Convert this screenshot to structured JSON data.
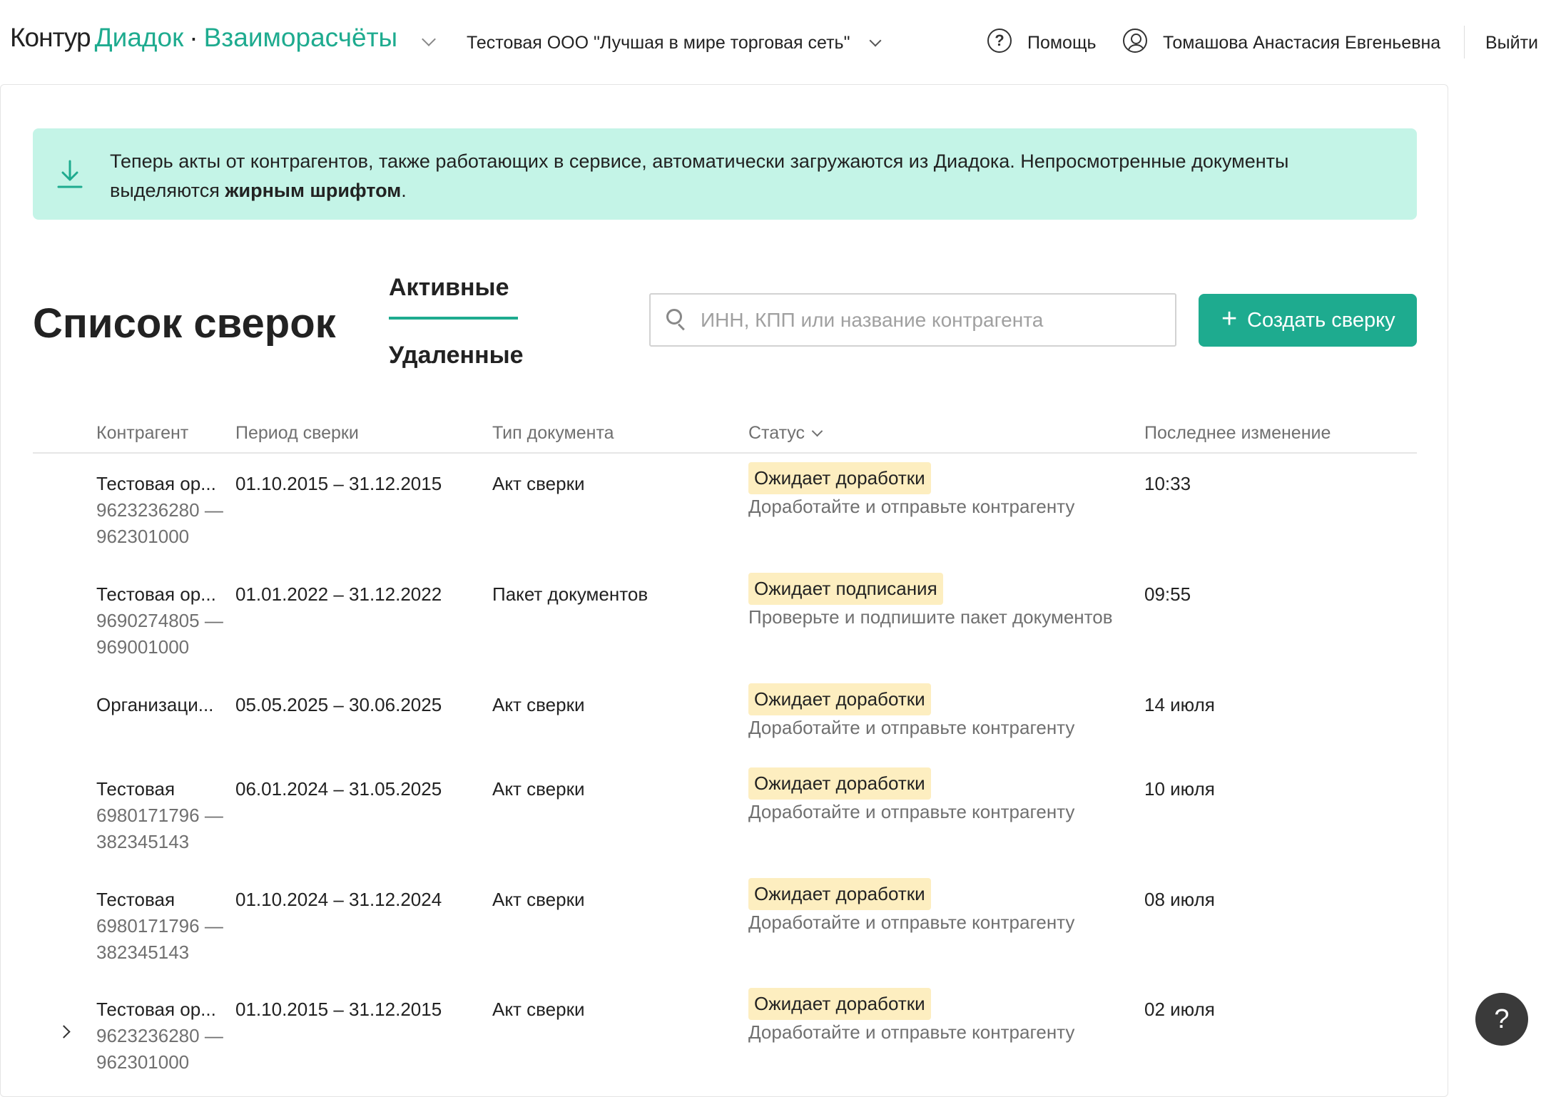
{
  "header": {
    "brand_kontur": "Контур",
    "brand_diadoc": "Диадок",
    "brand_dot": "·",
    "brand_product": "Взаиморасчёты",
    "org_name": "Тестовая ООО \"Лучшая в мире торговая сеть\"",
    "help_label": "Помощь",
    "user_name": "Томашова Анастасия Евгеньевна",
    "logout_label": "Выйти"
  },
  "banner": {
    "text_main": "Теперь акты от контрагентов, также работающих в сервисе, автоматически загружаются из Диадока. Непросмотренные документы выделяются ",
    "text_bold": "жирным шрифтом",
    "text_end": "."
  },
  "page": {
    "title": "Список сверок",
    "tabs": [
      {
        "label": "Активные",
        "active": true
      },
      {
        "label": "Удаленные",
        "active": false
      }
    ],
    "search_placeholder": "ИНН, КПП или название контрагента",
    "create_button_plus": "+",
    "create_button_label": "Создать сверку"
  },
  "table": {
    "columns": {
      "counterparty": "Контрагент",
      "period": "Период сверки",
      "doc_type": "Тип документа",
      "status": "Статус",
      "last_change": "Последнее изменение"
    },
    "rows": [
      {
        "name": "Тестовая ор...",
        "inn": "9623236280 —",
        "kpp": "962301000",
        "period": "01.10.2015 – 31.12.2015",
        "doc_type": "Акт сверки",
        "status": "Ожидает доработки",
        "hint": "Доработайте и отправьте контрагенту",
        "time": "10:33"
      },
      {
        "name": "Тестовая ор...",
        "inn": "9690274805 —",
        "kpp": "969001000",
        "period": "01.01.2022 – 31.12.2022",
        "doc_type": "Пакет документов",
        "status": "Ожидает подписания",
        "hint": "Проверьте и подпишите пакет документов",
        "time": "09:55"
      },
      {
        "name": "Организаци...",
        "inn": "",
        "kpp": "",
        "period": "05.05.2025 – 30.06.2025",
        "doc_type": "Акт сверки",
        "status": "Ожидает доработки",
        "hint": "Доработайте и отправьте контрагенту",
        "time": "14 июля"
      },
      {
        "name": "Тестовая",
        "inn": "6980171796 —",
        "kpp": "382345143",
        "period": "06.01.2024 – 31.05.2025",
        "doc_type": "Акт сверки",
        "status": "Ожидает доработки",
        "hint": "Доработайте и отправьте контрагенту",
        "time": "10 июля"
      },
      {
        "name": "Тестовая",
        "inn": "6980171796 —",
        "kpp": "382345143",
        "period": "01.10.2024 – 31.12.2024",
        "doc_type": "Акт сверки",
        "status": "Ожидает доработки",
        "hint": "Доработайте и отправьте контрагенту",
        "time": "08 июля"
      },
      {
        "name": "Тестовая ор...",
        "inn": "9623236280 —",
        "kpp": "962301000",
        "period": "01.10.2015 – 31.12.2015",
        "doc_type": "Акт сверки",
        "status": "Ожидает доработки",
        "hint": "Доработайте и отправьте контрагенту",
        "time": "02 июля"
      }
    ]
  },
  "help_fab": "?",
  "colors": {
    "accent": "#1eab8f",
    "banner_bg": "#c4f4e7",
    "badge_bg": "#fdeec0"
  },
  "icons": {
    "brand_menu": "chevron-down-icon",
    "help": "question-circle-icon",
    "user": "user-circle-icon",
    "banner": "download-icon",
    "search": "search-icon",
    "row_expand": "chevron-right-icon"
  }
}
